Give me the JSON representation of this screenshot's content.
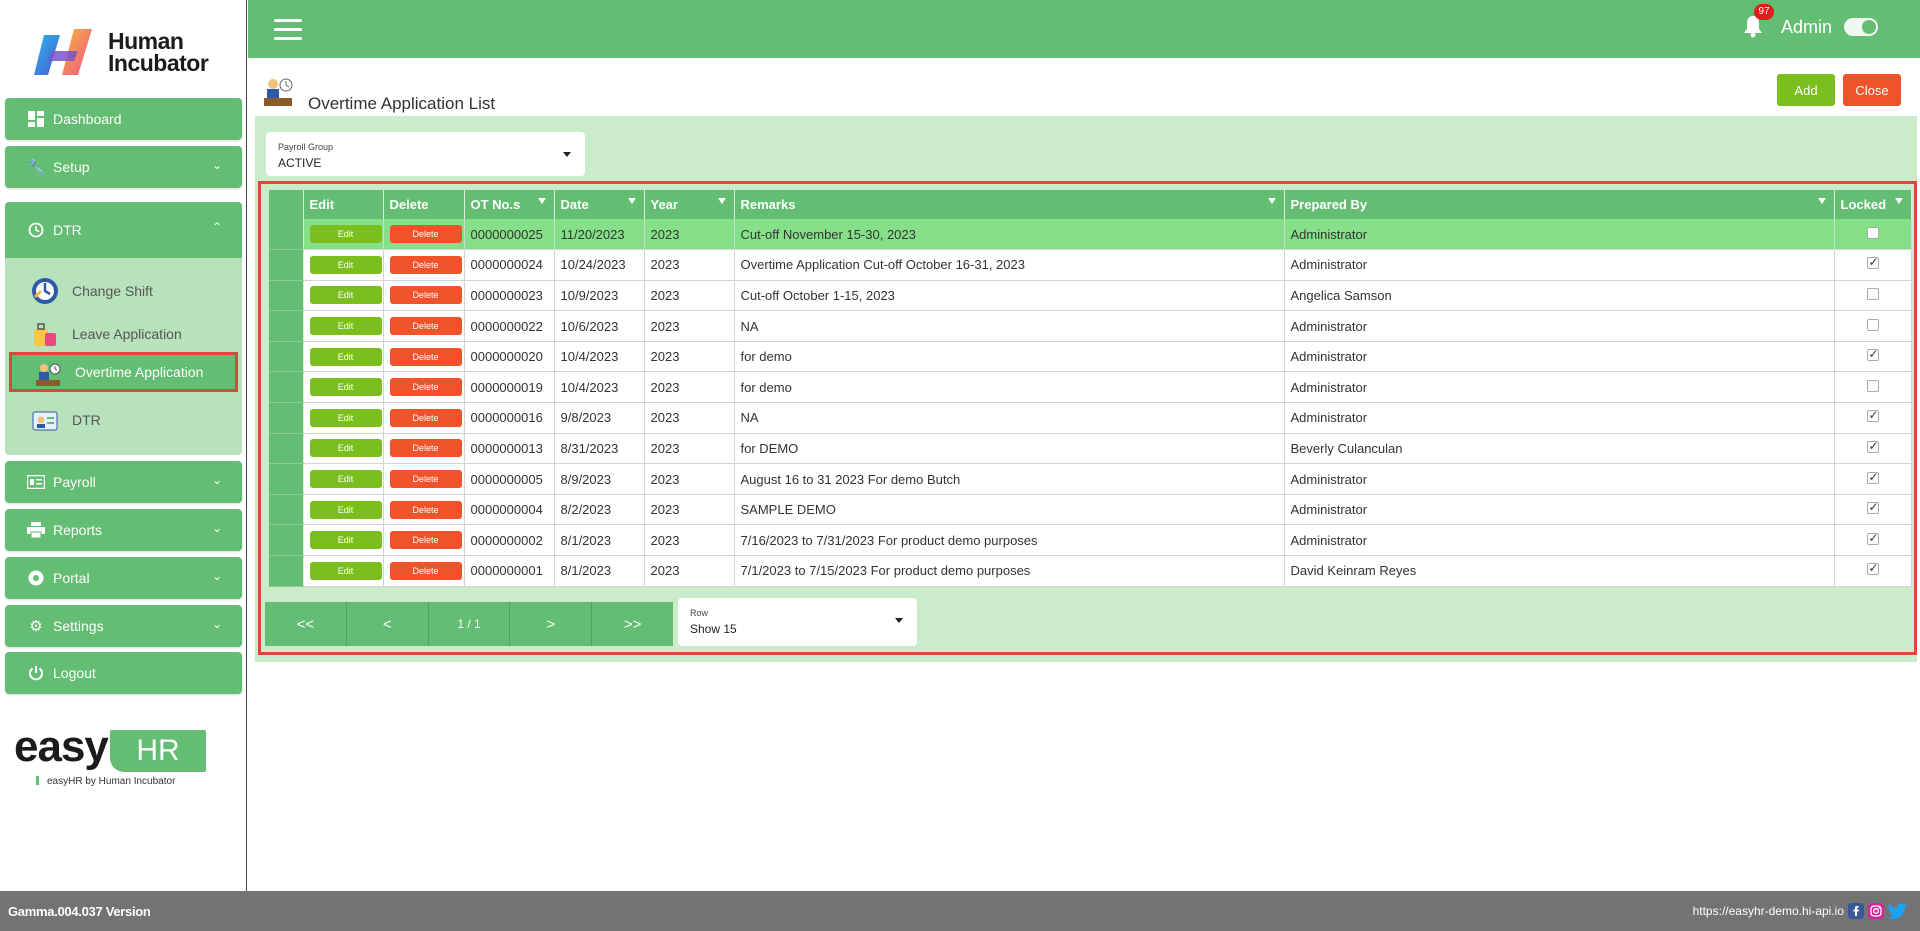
{
  "brand": {
    "name_line1": "Human",
    "name_line2": "Incubator",
    "easy_word": "easy",
    "hr_word": "HR",
    "byline": "easyHR by Human Incubator"
  },
  "sidebar": {
    "items": [
      {
        "label": "Dashboard",
        "icon": "dashboard-icon"
      },
      {
        "label": "Setup",
        "icon": "wrench-icon"
      },
      {
        "label": "DTR",
        "icon": "clock-icon"
      },
      {
        "label": "Payroll",
        "icon": "payroll-icon"
      },
      {
        "label": "Reports",
        "icon": "printer-icon"
      },
      {
        "label": "Portal",
        "icon": "aperture-icon"
      },
      {
        "label": "Settings",
        "icon": "gear-icon"
      },
      {
        "label": "Logout",
        "icon": "power-icon"
      }
    ],
    "dtr_sub": [
      {
        "label": "Change Shift",
        "icon": "change-shift-icon"
      },
      {
        "label": "Leave Application",
        "icon": "luggage-icon"
      },
      {
        "label": "Overtime Application",
        "icon": "overtime-icon"
      },
      {
        "label": "DTR",
        "icon": "id-card-icon"
      }
    ]
  },
  "topbar": {
    "notification_count": "97",
    "user": "Admin"
  },
  "page": {
    "title": "Overtime Application List",
    "add_label": "Add",
    "close_label": "Close"
  },
  "filter": {
    "label": "Payroll Group",
    "value": "ACTIVE"
  },
  "table": {
    "columns": [
      "Edit",
      "Delete",
      "OT No.s",
      "Date",
      "Year",
      "Remarks",
      "Prepared By",
      "Locked"
    ],
    "edit_label": "Edit",
    "delete_label": "Delete",
    "rows": [
      {
        "ot": "0000000025",
        "date": "11/20/2023",
        "year": "2023",
        "remarks": "Cut-off November 15-30, 2023",
        "by": "Administrator",
        "locked": false
      },
      {
        "ot": "0000000024",
        "date": "10/24/2023",
        "year": "2023",
        "remarks": "Overtime Application Cut-off October 16-31, 2023",
        "by": "Administrator",
        "locked": true
      },
      {
        "ot": "0000000023",
        "date": "10/9/2023",
        "year": "2023",
        "remarks": "Cut-off October 1-15, 2023",
        "by": "Angelica Samson",
        "locked": false
      },
      {
        "ot": "0000000022",
        "date": "10/6/2023",
        "year": "2023",
        "remarks": "NA",
        "by": "Administrator",
        "locked": false
      },
      {
        "ot": "0000000020",
        "date": "10/4/2023",
        "year": "2023",
        "remarks": "for demo",
        "by": "Administrator",
        "locked": true
      },
      {
        "ot": "0000000019",
        "date": "10/4/2023",
        "year": "2023",
        "remarks": "for demo",
        "by": "Administrator",
        "locked": false
      },
      {
        "ot": "0000000016",
        "date": "9/8/2023",
        "year": "2023",
        "remarks": "NA",
        "by": "Administrator",
        "locked": true
      },
      {
        "ot": "0000000013",
        "date": "8/31/2023",
        "year": "2023",
        "remarks": "for DEMO",
        "by": "Beverly Culanculan",
        "locked": true
      },
      {
        "ot": "0000000005",
        "date": "8/9/2023",
        "year": "2023",
        "remarks": "August 16 to 31 2023 For demo Butch",
        "by": "Administrator",
        "locked": true
      },
      {
        "ot": "0000000004",
        "date": "8/2/2023",
        "year": "2023",
        "remarks": "SAMPLE DEMO",
        "by": "Administrator",
        "locked": true
      },
      {
        "ot": "0000000002",
        "date": "8/1/2023",
        "year": "2023",
        "remarks": "7/16/2023 to 7/31/2023 For product demo purposes",
        "by": "Administrator",
        "locked": true
      },
      {
        "ot": "0000000001",
        "date": "8/1/2023",
        "year": "2023",
        "remarks": "7/1/2023 to 7/15/2023 For product demo purposes",
        "by": "David Keinram Reyes",
        "locked": true
      }
    ]
  },
  "pager": {
    "first": "<<",
    "prev": "<",
    "info": "1 / 1",
    "next": ">",
    "last": ">>"
  },
  "rows_select": {
    "label": "Row",
    "value": "Show 15"
  },
  "footer": {
    "version": "Gamma.004.037 Version",
    "url": "https://easyhr-demo.hi-api.io"
  },
  "colors": {
    "primary": "#63bd72",
    "light": "#cbeccb",
    "add": "#7bbf1f",
    "danger": "#f0522a",
    "highlight": "#d9483b"
  }
}
